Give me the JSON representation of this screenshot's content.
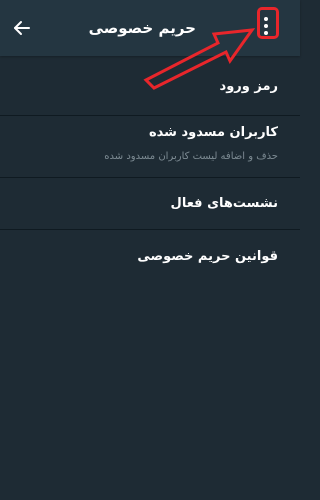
{
  "header": {
    "title": "حریم خصوصی"
  },
  "menu": {
    "items": [
      {
        "label": "رمز ورود"
      },
      {
        "label": "کاربران مسدود شده",
        "description": "حذف و اضافه لیست کاربران مسدود شده"
      },
      {
        "label": "نشست‌های فعال"
      },
      {
        "label": "قوانین حریم خصوصی"
      }
    ]
  },
  "icons": {
    "back": "arrow-left-icon",
    "more": "more-vertical-icon"
  },
  "colors": {
    "background": "#1e2b34",
    "toolbar": "#243641",
    "annotation": "#e8262b",
    "text": "#ffffff",
    "subtext": "#7d8b93"
  }
}
